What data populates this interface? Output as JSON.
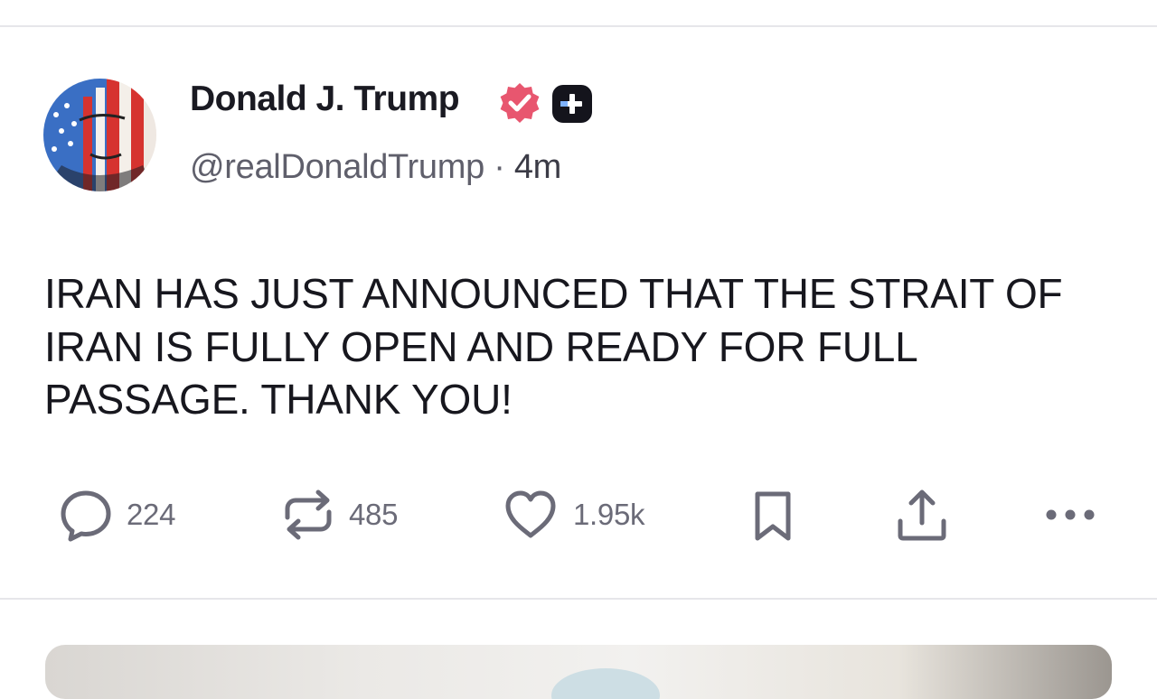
{
  "post": {
    "author": {
      "display_name": "Donald J. Trump",
      "handle": "@realDonaldTrump",
      "separator": "·",
      "time_ago": "4m",
      "verified_badge_color": "#e8566f",
      "badges": [
        "verified-badge-icon",
        "plus-badge-icon"
      ]
    },
    "text": "IRAN HAS JUST ANNOUNCED THAT THE STRAIT OF IRAN IS FULLY OPEN AND READY FOR FULL PASSAGE. THANK YOU!",
    "actions": {
      "replies": "224",
      "reposts": "485",
      "likes": "1.95k"
    },
    "action_icons": [
      "reply-icon",
      "repost-icon",
      "like-icon",
      "bookmark-icon",
      "share-icon",
      "more-icon"
    ]
  },
  "colors": {
    "text": "#17171e",
    "secondary": "#5f5f6b",
    "action_gray": "#6b6b78",
    "divider": "#e6e6ea",
    "verified": "#e8566f"
  }
}
